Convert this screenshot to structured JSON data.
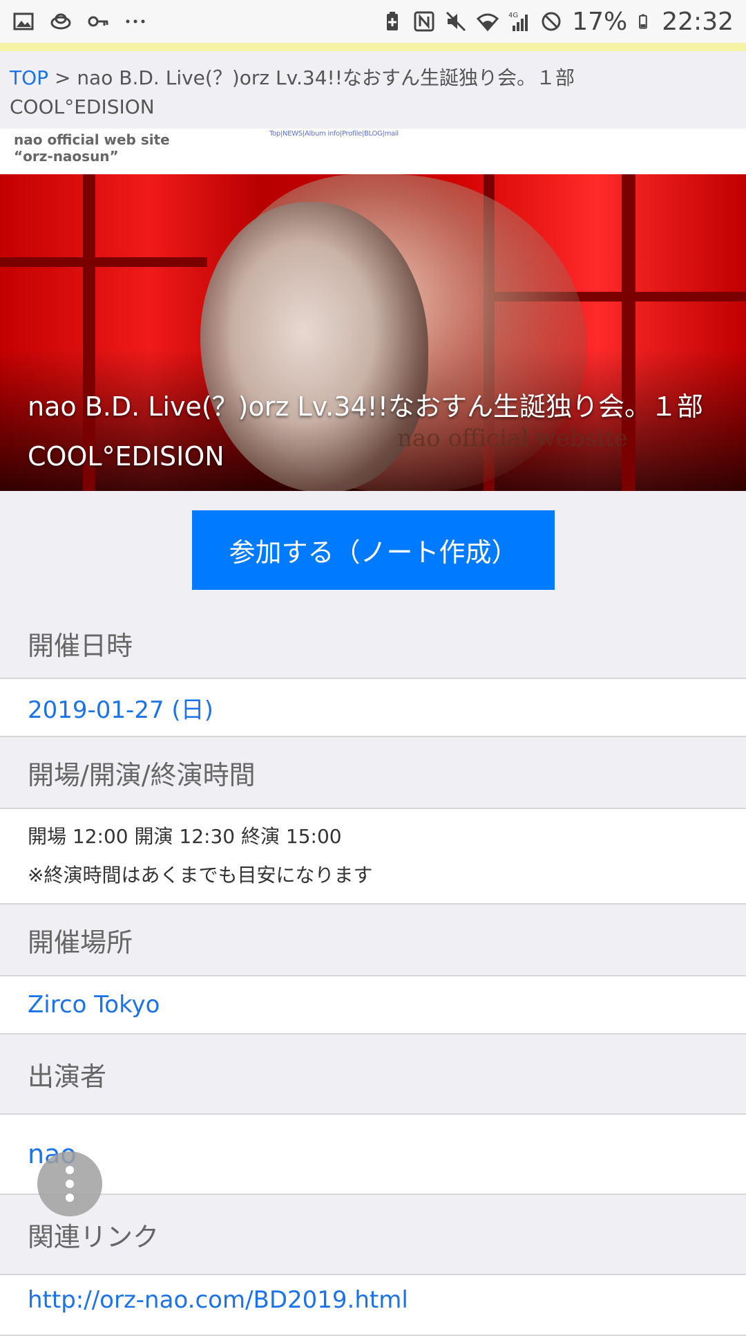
{
  "status_bar": {
    "battery": "17%",
    "time": "22:32",
    "icons_left": [
      "gallery-icon",
      "cloud-icon",
      "key-icon",
      "more-dots-icon"
    ],
    "icons_right": [
      "battery-saver-icon",
      "nfc-icon",
      "mute-icon",
      "wifi-icon",
      "signal-4g-icon",
      "block-icon",
      "battery-icon"
    ]
  },
  "breadcrumb": {
    "top_link": "TOP",
    "separator": ">",
    "current": "nao B.D. Live(？)orz Lv.34!!なおすん生誕独り会。１部　COOL°EDISION"
  },
  "banner": {
    "site_line1": "nao official web site",
    "site_line2": "“orz-naosun”",
    "mini_nav": "Top|NEWS|Album info|Profile|BLOG|mail",
    "watermark": "nao official website"
  },
  "event": {
    "title": "nao B.D. Live(？)orz Lv.34!!なおすん生誕独り会。１部　COOL°EDISION",
    "join_button": "参加する（ノート作成）",
    "sections": {
      "date_label": "開催日時",
      "date_value": "2019-01-27 (日)",
      "time_label": "開場/開演/終演時間",
      "time_value": "開場 12:00 開演 12:30 終演 15:00",
      "time_note": "※終演時間はあくまでも目安になります",
      "venue_label": "開催場所",
      "venue_value": "Zirco Tokyo",
      "performer_label": "出演者",
      "performer_value": "nao",
      "links_label": "関連リンク",
      "links_value": "http://orz-nao.com/BD2019.html"
    }
  },
  "colors": {
    "link": "#1a73e8",
    "button": "#007aff",
    "background": "#efeff4"
  }
}
